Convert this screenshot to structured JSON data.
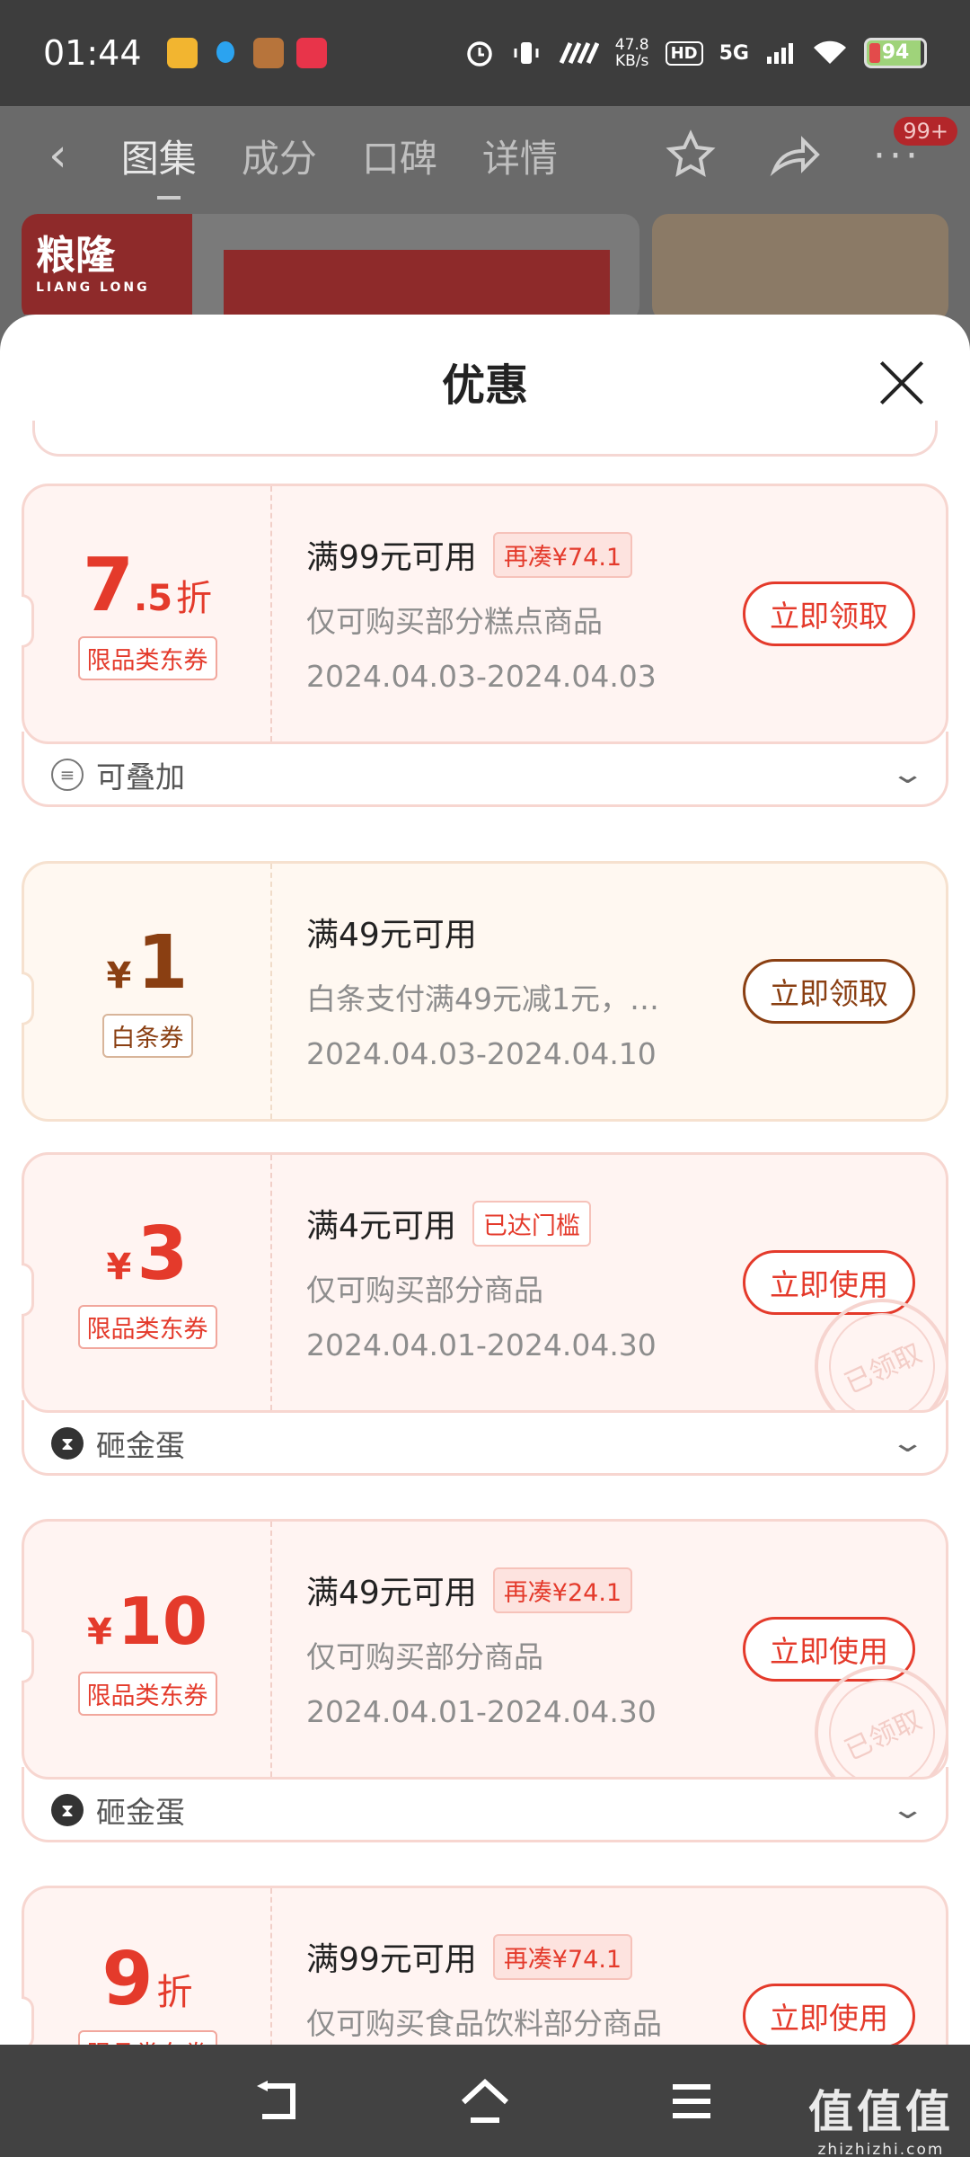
{
  "status": {
    "time": "01:44",
    "net_speed_top": "47.8",
    "net_speed_bottom": "KB/s",
    "hd": "HD",
    "network": "5G",
    "battery": "94"
  },
  "nav": {
    "tabs": [
      "图集",
      "成分",
      "口碑",
      "详情"
    ],
    "badge": "99+"
  },
  "banner": {
    "brand": "粮隆",
    "brand_sub": "LIANG LONG"
  },
  "sheet": {
    "title": "优惠"
  },
  "coupons": [
    {
      "amount_main": "7",
      "amount_dec": ".5",
      "amount_unit": "折",
      "type": "限品类东券",
      "condition": "满99元可用",
      "tag": "再凑¥74.1",
      "desc": "仅可购买部分糕点商品",
      "date": "2024.04.03-2024.04.03",
      "action": "立即领取",
      "foot_label": "可叠加"
    },
    {
      "currency": "¥",
      "amount_main": "1",
      "type": "白条券",
      "condition": "满49元可用",
      "desc": "白条支付满49元减1元，…",
      "date": "2024.04.03-2024.04.10",
      "action": "立即领取"
    },
    {
      "currency": "¥",
      "amount_main": "3",
      "type": "限品类东券",
      "condition": "满4元可用",
      "tag": "已达门槛",
      "desc": "仅可购买部分商品",
      "date": "2024.04.01-2024.04.30",
      "action": "立即使用",
      "stamp": "已领取",
      "foot_label": "砸金蛋"
    },
    {
      "currency": "¥",
      "amount_main": "10",
      "type": "限品类东券",
      "condition": "满49元可用",
      "tag": "再凑¥24.1",
      "desc": "仅可购买部分商品",
      "date": "2024.04.01-2024.04.30",
      "action": "立即使用",
      "stamp": "已领取",
      "foot_label": "砸金蛋"
    },
    {
      "amount_main": "9",
      "amount_unit": "折",
      "type": "限品类东券",
      "condition": "满99元可用",
      "tag": "再凑¥74.1",
      "desc": "仅可购买食品饮料部分商品",
      "action": "立即使用"
    }
  ],
  "watermark": {
    "line1": "值值值",
    "line2": "zhizhizhi.com"
  },
  "colors": {
    "accent_red": "#e43a2b",
    "accent_brown": "#8a3f12"
  }
}
